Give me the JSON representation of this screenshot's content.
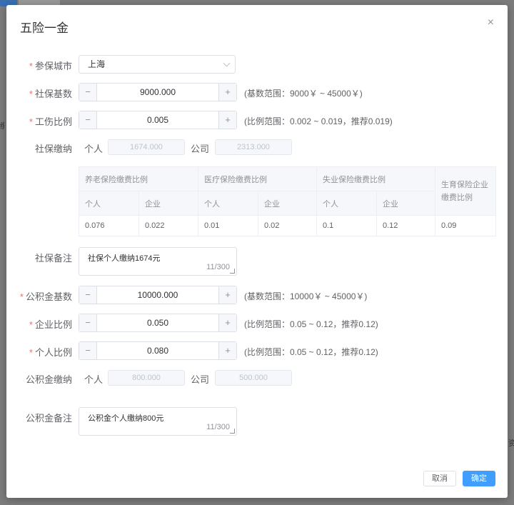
{
  "background": {
    "edge_right": "资",
    "edge_left": "缴"
  },
  "dialog": {
    "title": "五险一金",
    "close_icon": "×"
  },
  "form": {
    "city": {
      "label": "参保城市",
      "value": "上海"
    },
    "social_base": {
      "label": "社保基数",
      "value": "9000.000",
      "hint": "(基数范围：9000￥ ~ 45000￥)"
    },
    "injury_ratio": {
      "label": "工伤比例",
      "value": "0.005",
      "hint": "(比例范围：0.002 ~ 0.019，推荐0.019)"
    },
    "social_pay": {
      "label": "社保缴纳",
      "personal_label": "个人",
      "personal_value": "1674.000",
      "company_label": "公司",
      "company_value": "2313.000"
    },
    "rates_table": {
      "headers": [
        "养老保险缴费比例",
        "医疗保险缴费比例",
        "失业保险缴费比例",
        "生育保险企业缴费比例"
      ],
      "subheaders": [
        "个人",
        "企业",
        "个人",
        "企业",
        "个人",
        "企业"
      ],
      "values": [
        "0.076",
        "0.022",
        "0.01",
        "0.02",
        "0.1",
        "0.12",
        "0.09"
      ]
    },
    "social_note": {
      "label": "社保备注",
      "value": "社保个人缴纳1674元",
      "count": "11/300"
    },
    "fund_base": {
      "label": "公积金基数",
      "value": "10000.000",
      "hint": "(基数范围：10000￥ ~ 45000￥)"
    },
    "company_ratio": {
      "label": "企业比例",
      "value": "0.050",
      "hint": "(比例范围：0.05 ~ 0.12，推荐0.12)"
    },
    "personal_ratio": {
      "label": "个人比例",
      "value": "0.080",
      "hint": "(比例范围：0.05 ~ 0.12，推荐0.12)"
    },
    "fund_pay": {
      "label": "公积金缴纳",
      "personal_label": "个人",
      "personal_value": "800.000",
      "company_label": "公司",
      "company_value": "500.000"
    },
    "fund_note": {
      "label": "公积金备注",
      "value": "公积金个人缴纳800元",
      "count": "11/300"
    }
  },
  "footer": {
    "cancel": "取消",
    "confirm": "确定"
  },
  "stepper": {
    "minus": "−",
    "plus": "+"
  },
  "required_mark": "*"
}
